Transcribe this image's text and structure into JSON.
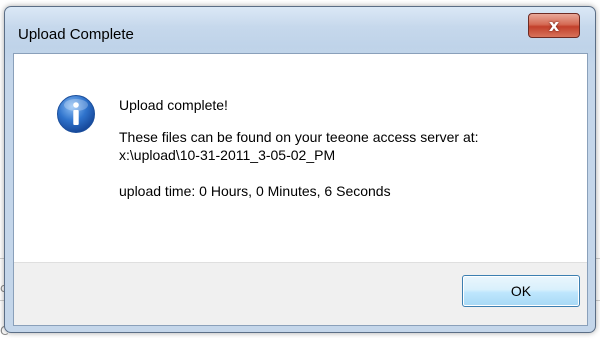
{
  "background": {
    "left_char": "c",
    "bottom_char": "C"
  },
  "dialog": {
    "title": "Upload Complete",
    "close_label": "x",
    "heading": "Upload complete!",
    "location_text": "These files can be found on your teeone access server at:",
    "path": "x:\\upload\\10-31-2011_3-05-02_PM",
    "upload_time": "upload time: 0 Hours, 0 Minutes, 6 Seconds",
    "ok_label": "OK"
  },
  "colors": {
    "window_frame": "#bfd3e9",
    "close_button": "#c2402b",
    "ok_button": "#bee6fd",
    "info_icon": "#1f5fb8"
  }
}
